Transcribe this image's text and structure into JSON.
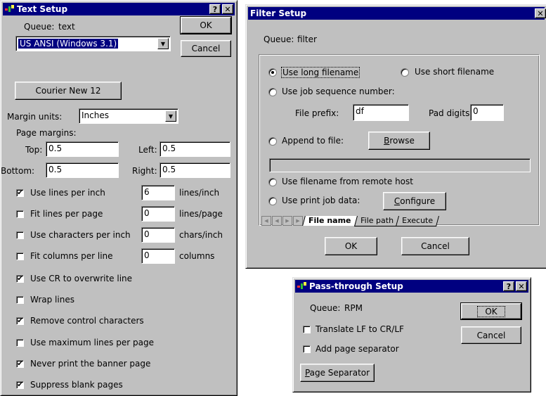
{
  "colors": {
    "title_bar": "#000080",
    "dialog_face": "#c0c0c0"
  },
  "text_setup": {
    "title": "Text Setup",
    "help_btn": "?",
    "close_btn": "✕",
    "queue_label": "Queue:",
    "queue_value": "text",
    "ok": "OK",
    "cancel": "Cancel",
    "charset": "US ANSI (Windows 3.1)",
    "font_button": "Courier New 12",
    "margin_units_label": "Margin units:",
    "margin_units_value": "Inches",
    "page_margins_label": "Page margins:",
    "top_label": "Top:",
    "top_value": "0.5",
    "left_label": "Left:",
    "left_value": "0.5",
    "bottom_label": "Bottom:",
    "bottom_value": "0.5",
    "right_label": "Right:",
    "right_value": "0.5",
    "options": [
      {
        "label": "Use lines per inch",
        "checked": true,
        "value": "6",
        "unit": "lines/inch"
      },
      {
        "label": "Fit lines per page",
        "checked": false,
        "value": "0",
        "unit": "lines/page"
      },
      {
        "label": "Use characters per inch",
        "checked": false,
        "value": "0",
        "unit": "chars/inch"
      },
      {
        "label": "Fit columns per line",
        "checked": false,
        "value": "0",
        "unit": "columns"
      },
      {
        "label": "Use CR to overwrite line",
        "checked": true
      },
      {
        "label": "Wrap lines",
        "checked": false
      },
      {
        "label": "Remove control characters",
        "checked": true
      },
      {
        "label": "Use maximum lines per page",
        "checked": false
      },
      {
        "label": "Never print the banner page",
        "checked": true
      },
      {
        "label": "Suppress blank pages",
        "checked": true
      }
    ]
  },
  "filter_setup": {
    "title": "Filter Setup",
    "close_btn": "✕",
    "queue_label": "Queue:",
    "queue_value": "filter",
    "use_long": "Use long filename",
    "use_short": "Use short filename",
    "use_jobseq": "Use job sequence number:",
    "file_prefix_label": "File prefix:",
    "file_prefix_value": "df",
    "pad_digits_label": "Pad digits",
    "pad_digits_value": "0",
    "append_label": "Append to file:",
    "browse_prefix": "",
    "browse_ul": "B",
    "browse_rest": "rowse",
    "remote_label": "Use filename from remote host",
    "printjob_label": "Use print job data:",
    "configure_ul": "C",
    "configure_rest": "onfigure",
    "tabs": [
      "File name",
      "File path",
      "Execute"
    ],
    "ok": "OK",
    "cancel": "Cancel"
  },
  "passthrough_setup": {
    "title": "Pass-through Setup",
    "help_btn": "?",
    "close_btn": "✕",
    "queue_label": "Queue:",
    "queue_value": "RPM",
    "ok": "OK",
    "cancel": "Cancel",
    "translate_label": "Translate LF to CR/LF",
    "add_sep_label": "Add page separator",
    "page_sep_ul": "P",
    "page_sep_rest": "age Separator"
  }
}
